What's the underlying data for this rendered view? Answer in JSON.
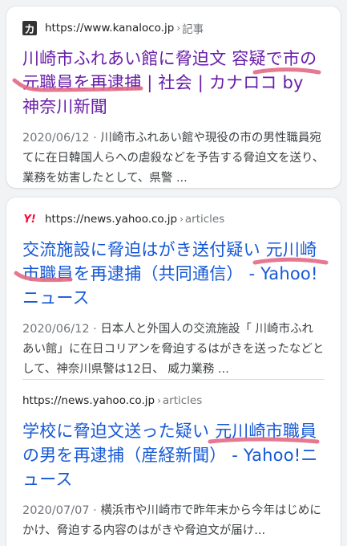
{
  "results": [
    {
      "favicon_icon": "kanagawa-shimbun-favicon-icon",
      "favicon_glyph": "カ",
      "url": "https://www.kanaloco.jp",
      "crumb_sep": "›",
      "crumb": "記事",
      "title": "川崎市ふれあい館に脅迫文 容疑で市の元職員を再逮捕 | 社会 | カナロコ by 神奈川新聞",
      "date": "2020/06/12",
      "date_sep": " · ",
      "snippet": "川崎市ふれあい館や現役の市の男性職員宛てに在日韓国人らへの虐殺などを予告する脅迫文を送り、業務を妨害したとして、県警 ..."
    },
    {
      "favicon_icon": "yahoo-favicon-icon",
      "favicon_glyph": "Y!",
      "url": "https://news.yahoo.co.jp",
      "crumb_sep": "›",
      "crumb": "articles",
      "title": "交流施設に脅迫はがき送付疑い 元川崎市職員を再逮捕（共同通信） - Yahoo!ニュース",
      "date": "2020/06/12",
      "date_sep": " · ",
      "snippet": "日本人と外国人の交流施設「 川崎市ふれあい館」に在日コリアンを脅迫するはがきを送ったなどとして、神奈川県警は12日、 威力業務 ..."
    },
    {
      "url": "https://news.yahoo.co.jp",
      "crumb_sep": "›",
      "crumb": "articles",
      "title": "学校に脅迫文送った疑い 元川崎市職員の男を再逮捕（産経新聞） - Yahoo!ニュース",
      "date": "2020/07/07",
      "date_sep": " · ",
      "snippet": "横浜市や川崎市で昨年末から今年はじめにかけ、脅迫する内容のはがきや脅迫文が届け..."
    }
  ],
  "colors": {
    "visited_link": "#681da8",
    "link": "#1558d6",
    "annotation": "#e36a86",
    "background": "#f1f3f4"
  }
}
